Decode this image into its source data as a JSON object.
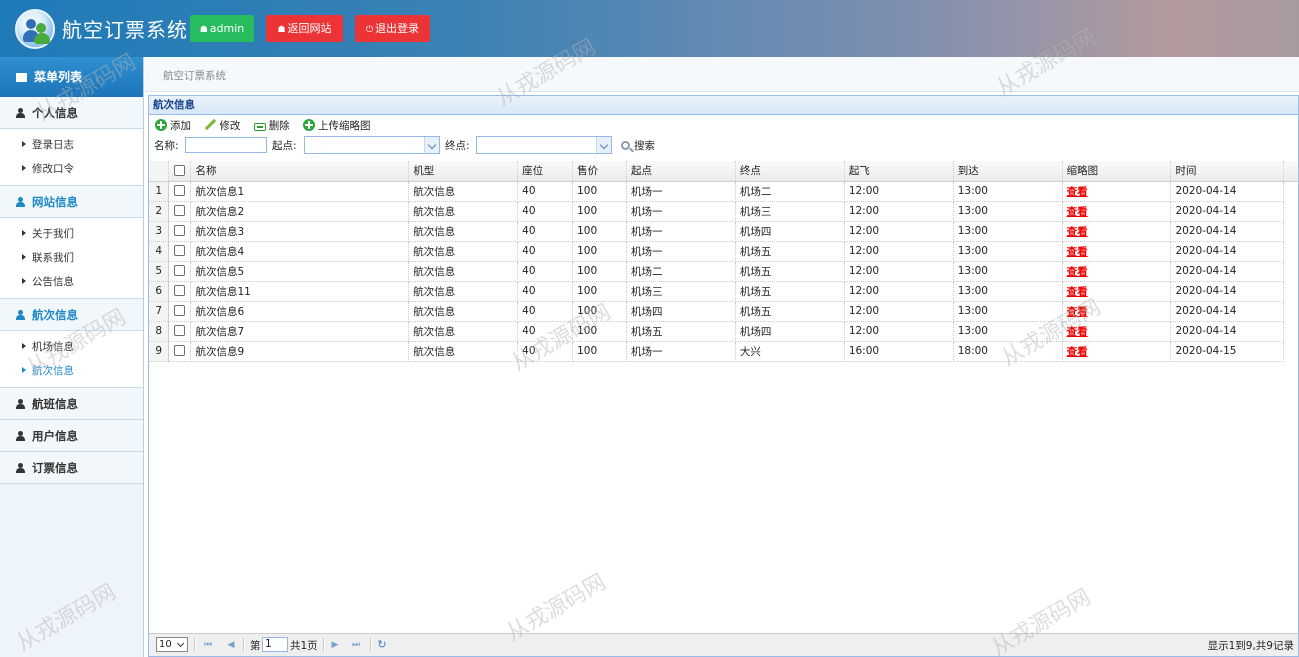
{
  "header": {
    "title": "航空订票系统",
    "admin_label": "admin",
    "home_label": "返回网站",
    "logout_label": "退出登录",
    "accent_green": "#27bd5e",
    "accent_red": "#ec3436"
  },
  "sidebar": {
    "header": "菜单列表",
    "groups": [
      {
        "label": "个人信息",
        "items": [
          "登录日志",
          "修改口令"
        ]
      },
      {
        "label": "网站信息",
        "items": [
          "关于我们",
          "联系我们",
          "公告信息"
        ]
      },
      {
        "label": "航次信息",
        "items": [
          "机场信息",
          "航次信息"
        ]
      },
      {
        "label": "航班信息",
        "items": []
      },
      {
        "label": "用户信息",
        "items": []
      },
      {
        "label": "订票信息",
        "items": []
      }
    ]
  },
  "breadcrumb": "航空订票系统",
  "panel": {
    "title": "航次信息",
    "toolbar": {
      "add": "添加",
      "edit": "修改",
      "delete": "删除",
      "upload": "上传缩略图"
    },
    "search": {
      "name_label": "名称:",
      "from_label": "起点:",
      "to_label": "终点:",
      "search_label": "搜索"
    }
  },
  "table": {
    "columns": [
      "名称",
      "机型",
      "座位",
      "售价",
      "起点",
      "终点",
      "起飞",
      "到达",
      "缩略图",
      "时间"
    ],
    "rows": [
      {
        "n": "1",
        "name": "航次信息1",
        "model": "航次信息",
        "seats": "40",
        "price": "100",
        "from": "机场一",
        "to": "机场二",
        "dep": "12:00",
        "arr": "13:00",
        "thumb": "查看",
        "date": "2020-04-14"
      },
      {
        "n": "2",
        "name": "航次信息2",
        "model": "航次信息",
        "seats": "40",
        "price": "100",
        "from": "机场一",
        "to": "机场三",
        "dep": "12:00",
        "arr": "13:00",
        "thumb": "查看",
        "date": "2020-04-14"
      },
      {
        "n": "3",
        "name": "航次信息3",
        "model": "航次信息",
        "seats": "40",
        "price": "100",
        "from": "机场一",
        "to": "机场四",
        "dep": "12:00",
        "arr": "13:00",
        "thumb": "查看",
        "date": "2020-04-14"
      },
      {
        "n": "4",
        "name": "航次信息4",
        "model": "航次信息",
        "seats": "40",
        "price": "100",
        "from": "机场一",
        "to": "机场五",
        "dep": "12:00",
        "arr": "13:00",
        "thumb": "查看",
        "date": "2020-04-14"
      },
      {
        "n": "5",
        "name": "航次信息5",
        "model": "航次信息",
        "seats": "40",
        "price": "100",
        "from": "机场二",
        "to": "机场五",
        "dep": "12:00",
        "arr": "13:00",
        "thumb": "查看",
        "date": "2020-04-14"
      },
      {
        "n": "6",
        "name": "航次信息11",
        "model": "航次信息",
        "seats": "40",
        "price": "100",
        "from": "机场三",
        "to": "机场五",
        "dep": "12:00",
        "arr": "13:00",
        "thumb": "查看",
        "date": "2020-04-14"
      },
      {
        "n": "7",
        "name": "航次信息6",
        "model": "航次信息",
        "seats": "40",
        "price": "100",
        "from": "机场四",
        "to": "机场五",
        "dep": "12:00",
        "arr": "13:00",
        "thumb": "查看",
        "date": "2020-04-14"
      },
      {
        "n": "8",
        "name": "航次信息7",
        "model": "航次信息",
        "seats": "40",
        "price": "100",
        "from": "机场五",
        "to": "机场四",
        "dep": "12:00",
        "arr": "13:00",
        "thumb": "查看",
        "date": "2020-04-14"
      },
      {
        "n": "9",
        "name": "航次信息9",
        "model": "航次信息",
        "seats": "40",
        "price": "100",
        "from": "机场一",
        "to": "大兴",
        "dep": "16:00",
        "arr": "18:00",
        "thumb": "查看",
        "date": "2020-04-15"
      }
    ]
  },
  "pager": {
    "page_size": "10",
    "page_prefix": "第",
    "page_value": "1",
    "page_suffix": "共1页",
    "info": "显示1到9,共9记录"
  },
  "watermark": "从戎源码网"
}
